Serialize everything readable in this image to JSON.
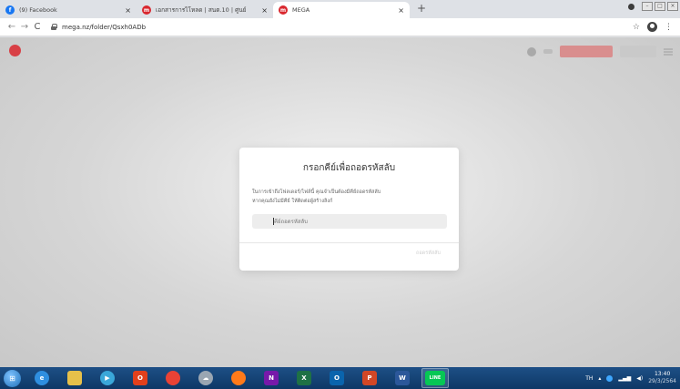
{
  "browser": {
    "tabs": [
      {
        "title": "(9) Facebook",
        "favicon": "facebook-icon",
        "active": false
      },
      {
        "title": "เอกสารการไโหลด | สนต.10 | ศูนย์",
        "favicon": "mega-icon",
        "active": false
      },
      {
        "title": "MEGA",
        "favicon": "mega-icon",
        "active": true
      }
    ],
    "close_glyph": "×",
    "new_tab_glyph": "+",
    "url": "mega.nz/folder/Qsxh0ADb"
  },
  "dialog": {
    "title": "กรอกคีย์เพื่อถอดรหัสลับ",
    "description_line1": "ในการเข้าถึงโฟลเดอร์/ไฟล์นี้ คุณจำเป็นต้องมีคีย์ถอดรหัสลับ",
    "description_line2": "หากคุณยังไม่มีคีย์ ให้ติดต่อผู้สร้างลิงก์",
    "input_placeholder": "คีย์ถอดรหัสลับ",
    "submit_label": "ถอดรหัสลับ"
  },
  "taskbar": {
    "apps": [
      {
        "name": "internet-explorer",
        "glyph": "e",
        "color": "#2f8fe0"
      },
      {
        "name": "file-explorer",
        "glyph": "",
        "color": "#e6c04a"
      },
      {
        "name": "media-player",
        "glyph": "▶",
        "color": "#3aa7d9"
      },
      {
        "name": "office",
        "glyph": "O",
        "color": "#e2401c"
      },
      {
        "name": "chrome",
        "glyph": "",
        "color": "#e94235"
      },
      {
        "name": "cloud-app",
        "glyph": "☁",
        "color": "#9aa6b2"
      },
      {
        "name": "firefox",
        "glyph": "",
        "color": "#ff7a1a"
      },
      {
        "name": "onenote",
        "glyph": "N",
        "color": "#7719aa"
      },
      {
        "name": "excel",
        "glyph": "X",
        "color": "#1e7145"
      },
      {
        "name": "outlook",
        "glyph": "O",
        "color": "#0a64ad"
      },
      {
        "name": "powerpoint",
        "glyph": "P",
        "color": "#d24726"
      },
      {
        "name": "word",
        "glyph": "W",
        "color": "#2b579a"
      },
      {
        "name": "line",
        "glyph": "LINE",
        "color": "#06c755"
      }
    ],
    "tray_lang": "TH",
    "clock_time": "13:40",
    "clock_date": "29/3/2564"
  },
  "colors": {
    "mega_red": "#d9272e",
    "taskbar_blue": "#1d4f86"
  }
}
